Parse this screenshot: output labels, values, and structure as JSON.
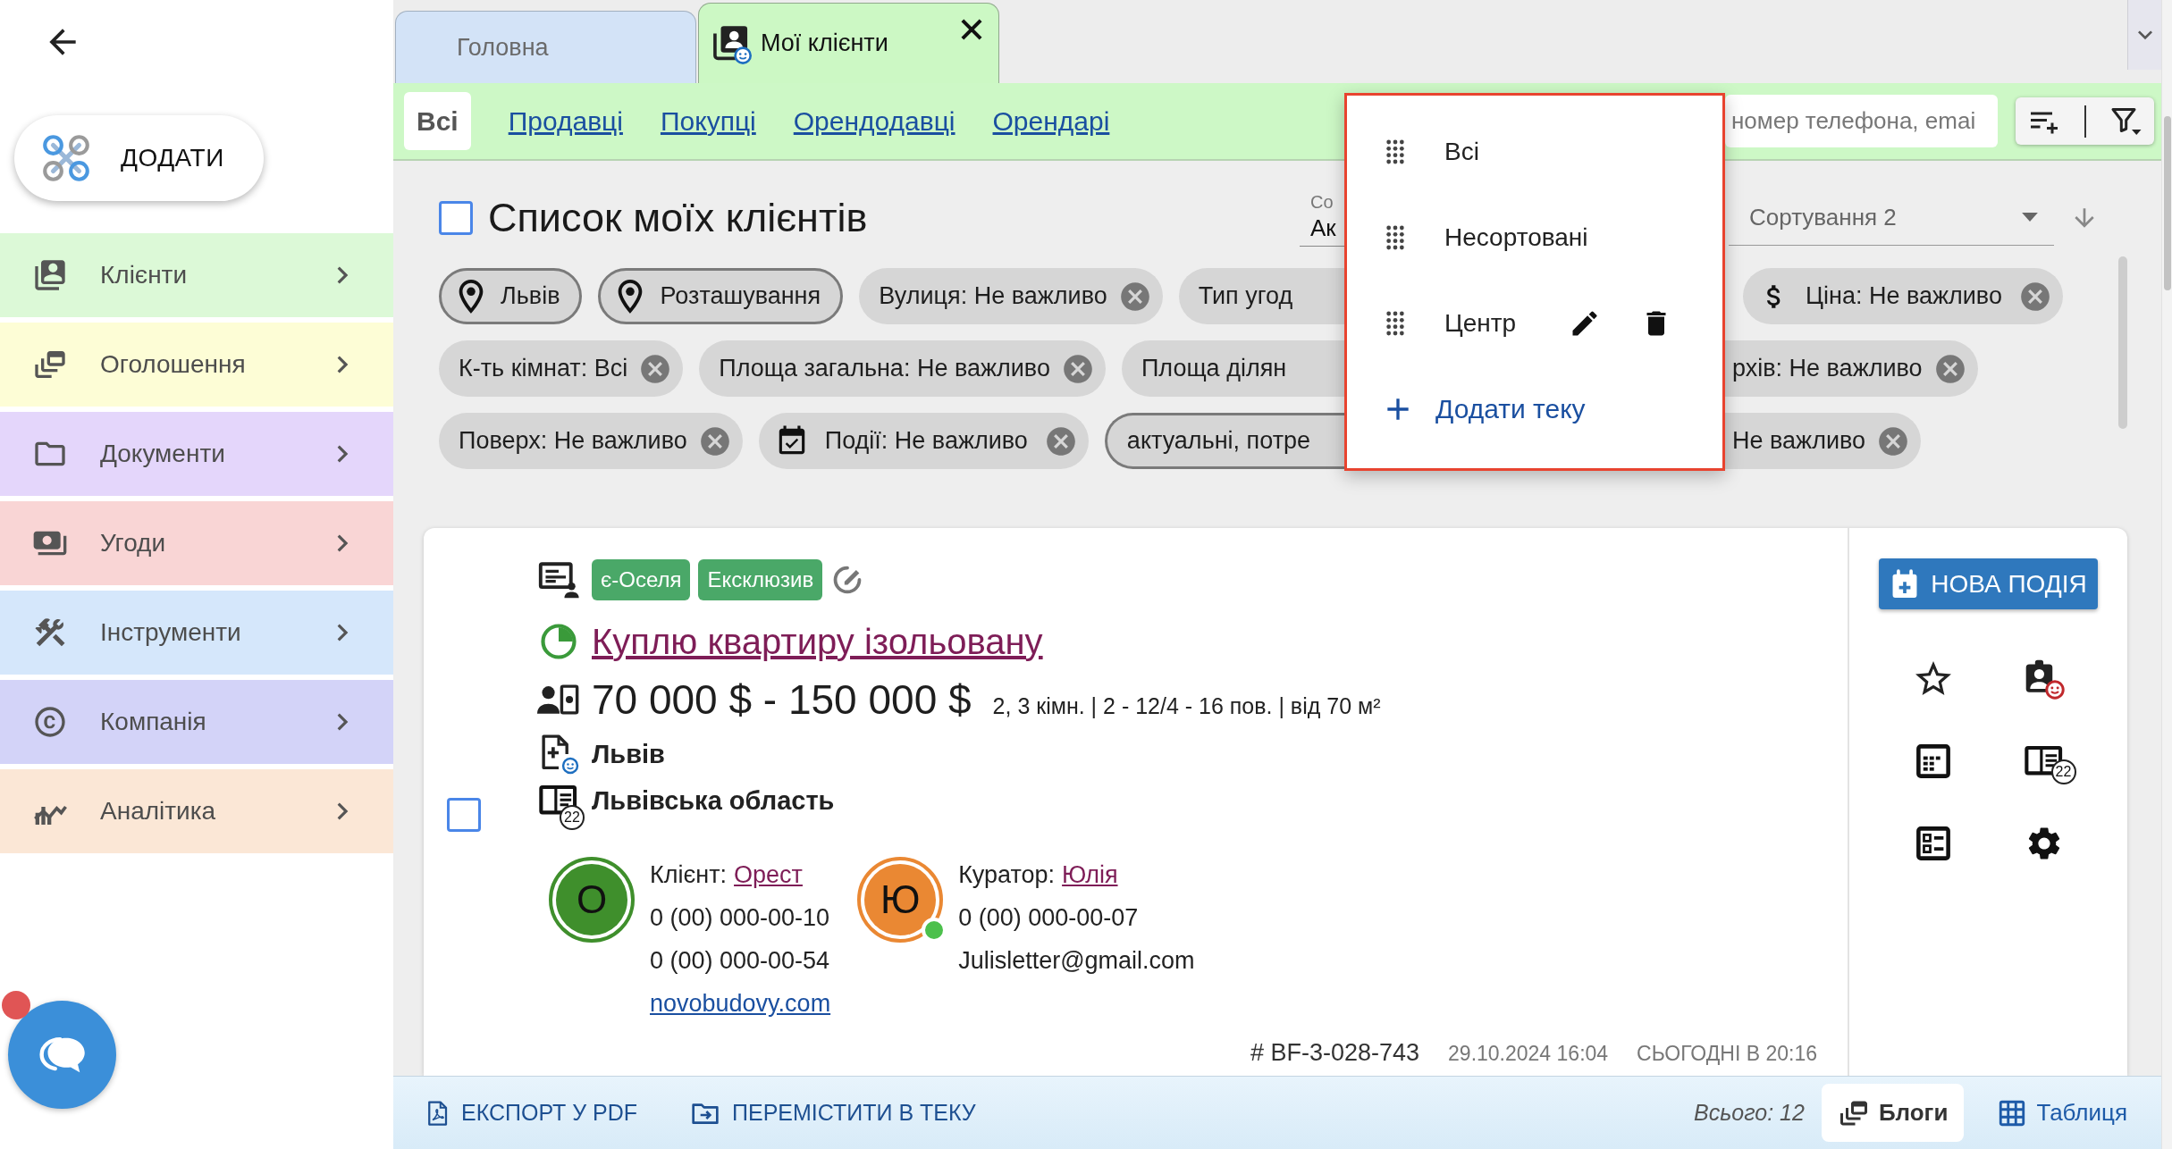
{
  "sidebar": {
    "add_button": {
      "label": "ДОДАТИ"
    },
    "items": [
      {
        "label": "Клієнти",
        "color": "#dcf9d7"
      },
      {
        "label": "Оголошення",
        "color": "#fdfdd6"
      },
      {
        "label": "Документи",
        "color": "#e4d6fb"
      },
      {
        "label": "Угоди",
        "color": "#f9d5d5"
      },
      {
        "label": "Інструменти",
        "color": "#d5e7fb"
      },
      {
        "label": "Компанія",
        "color": "#d3d3f8"
      },
      {
        "label": "Аналітика",
        "color": "#fbe7d6"
      }
    ],
    "chat": {
      "unread": true
    }
  },
  "tabs": [
    {
      "label": "Головна",
      "kind": "page",
      "selected": false,
      "closable": false
    },
    {
      "label": "Мої клієнти",
      "kind": "clients",
      "selected": true,
      "closable": true
    }
  ],
  "subtabs": [
    {
      "label": "Всі",
      "selected": true
    },
    {
      "label": "Продавці",
      "selected": false
    },
    {
      "label": "Покупці",
      "selected": false
    },
    {
      "label": "Орендодавці",
      "selected": false
    },
    {
      "label": "Орендарі",
      "selected": false
    }
  ],
  "search": {
    "placeholder": "номер телефона, emai"
  },
  "folder_menu": {
    "items": [
      {
        "label": "Всі",
        "editable": false
      },
      {
        "label": "Несортовані",
        "editable": false
      },
      {
        "label": "Центр",
        "editable": true
      }
    ],
    "add_label": "Додати теку"
  },
  "header": {
    "checked": false,
    "title": "Список моїх клієнтів",
    "sort_1": {
      "label": "Со",
      "value": "Ак"
    },
    "sort_2": {
      "label": "Сортування 2"
    }
  },
  "filters": [
    {
      "chips": [
        {
          "label": "Львів",
          "kind": "place",
          "covered_end": false,
          "covered_start": false
        },
        {
          "label": "Розташування",
          "kind": "place",
          "covered_end": false,
          "covered_start": false
        },
        {
          "label": "Вулиця: Не важливо",
          "kind": "filter",
          "covered_end": false,
          "covered_start": false
        },
        {
          "label": "Тип угод",
          "kind": "filter",
          "covered_end": true,
          "covered_start": false
        },
        {
          "label": "Ціна: Не важливо",
          "kind": "price",
          "covered_end": false,
          "covered_start": false
        }
      ]
    },
    {
      "chips": [
        {
          "label": "К-ть кімнат: Всі",
          "kind": "filter",
          "covered_end": false,
          "covered_start": false
        },
        {
          "label": "Площа загальна: Не важливо",
          "kind": "filter",
          "covered_end": false,
          "covered_start": false
        },
        {
          "label": "Площа ділян",
          "kind": "filter",
          "covered_end": true,
          "covered_start": false
        },
        {
          "label": "рхів: Не важливо",
          "kind": "filter",
          "covered_end": false,
          "covered_start": true
        }
      ]
    },
    {
      "chips": [
        {
          "label": "Поверх: Не важливо",
          "kind": "filter",
          "covered_end": false,
          "covered_start": false
        },
        {
          "label": "Події: Не важливо",
          "kind": "events",
          "covered_end": false,
          "covered_start": false
        },
        {
          "label": "актуальні, потре",
          "kind": "status",
          "covered_end": true,
          "covered_start": false
        },
        {
          "label": "Не важливо",
          "kind": "filter",
          "covered_end": false,
          "covered_start": true
        }
      ]
    }
  ],
  "listing": {
    "checked": false,
    "badges": [
      "є-Оселя",
      "Ексклюзив"
    ],
    "title": "Куплю квартиру ізольовану",
    "price": "70 000 $ - 150 000 $",
    "details": "2, 3 кімн. | 2 - 12/4 - 16 пов. | від 70 м²",
    "city": "Львів",
    "region": "Львівська область",
    "region_count": "22",
    "contacts": [
      {
        "role": "Клієнт:",
        "name": "Орест",
        "initial": "О",
        "color": "#3f8f2c",
        "online": false,
        "lines": [
          "0 (00) 000-00-10",
          "0 (00) 000-00-54"
        ],
        "website": "novobudovy.com"
      },
      {
        "role": "Куратор:",
        "name": "Юлія",
        "initial": "Ю",
        "color": "#ea8833",
        "online": true,
        "lines": [
          "0 (00) 000-00-07",
          "Julisletter@gmail.com"
        ]
      }
    ],
    "code": "# BF-3-028-743",
    "created": "29.10.2024 16:04",
    "updated": "СЬОГОДНІ В 20:16",
    "new_event": "НОВА ПОДІЯ",
    "actions_count": "22"
  },
  "bottom_bar": {
    "actions": [
      {
        "label": "ЕКСПОРТ У PDF",
        "kind": "pdf"
      },
      {
        "label": "ПЕРЕМІСТИТИ В ТЕКУ",
        "kind": "move"
      }
    ],
    "total": "Всього: 12",
    "views": [
      {
        "label": "Блоги",
        "kind": "blogs",
        "selected": true
      },
      {
        "label": "Таблиця",
        "kind": "table",
        "selected": false
      }
    ]
  }
}
